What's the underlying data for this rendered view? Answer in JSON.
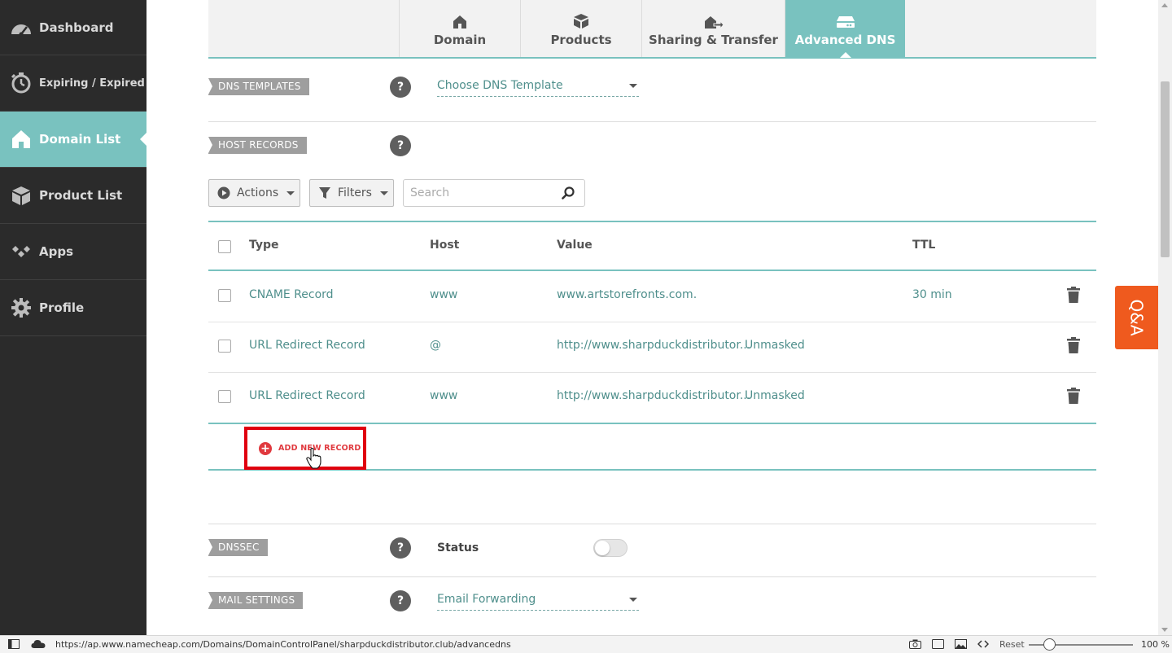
{
  "sidebar": {
    "items": [
      {
        "label": "Dashboard",
        "icon": "speedometer-icon"
      },
      {
        "label": "Expiring / Expired",
        "icon": "timer-icon"
      },
      {
        "label": "Domain List",
        "icon": "home-icon",
        "active": true
      },
      {
        "label": "Product List",
        "icon": "box-icon"
      },
      {
        "label": "Apps",
        "icon": "apps-icon"
      },
      {
        "label": "Profile",
        "icon": "gear-icon"
      }
    ]
  },
  "tabs": [
    {
      "label": "Domain",
      "icon": "home-icon"
    },
    {
      "label": "Products",
      "icon": "box-icon"
    },
    {
      "label": "Sharing & Transfer",
      "icon": "transfer-icon"
    },
    {
      "label": "Advanced DNS",
      "icon": "server-icon",
      "active": true
    }
  ],
  "dns_templates": {
    "label": "DNS TEMPLATES",
    "help": "?",
    "dropdown": "Choose DNS Template"
  },
  "host_records": {
    "label": "HOST RECORDS",
    "help": "?",
    "actions_label": "Actions",
    "filters_label": "Filters",
    "search_placeholder": "Search",
    "columns": {
      "type": "Type",
      "host": "Host",
      "value": "Value",
      "ttl": "TTL"
    },
    "rows": [
      {
        "type": "CNAME Record",
        "host": "www",
        "value": "www.artstorefronts.com.",
        "extra": "",
        "ttl": "30 min"
      },
      {
        "type": "URL Redirect Record",
        "host": "@",
        "value": "http://www.sharpduckdistributor...",
        "extra": "Unmasked",
        "ttl": ""
      },
      {
        "type": "URL Redirect Record",
        "host": "www",
        "value": "http://www.sharpduckdistributor...",
        "extra": "Unmasked",
        "ttl": ""
      }
    ],
    "add_label": "ADD NEW RECORD"
  },
  "dnssec": {
    "label": "DNSSEC",
    "help": "?",
    "status_label": "Status",
    "enabled": false
  },
  "mail_settings": {
    "label": "MAIL SETTINGS",
    "help": "?",
    "dropdown": "Email Forwarding"
  },
  "qa_tab": "Q&A",
  "statusbar": {
    "url": "https://ap.www.namecheap.com/Domains/DomainControlPanel/sharpduckdistributor.club/advancedns",
    "reset_label": "Reset",
    "zoom": "100 %"
  },
  "colors": {
    "sidebar_bg": "#2b2b2b",
    "accent": "#79c2bf",
    "link": "#4f8f8c",
    "highlight_box": "#e0000f",
    "qa": "#ef5a1e"
  }
}
